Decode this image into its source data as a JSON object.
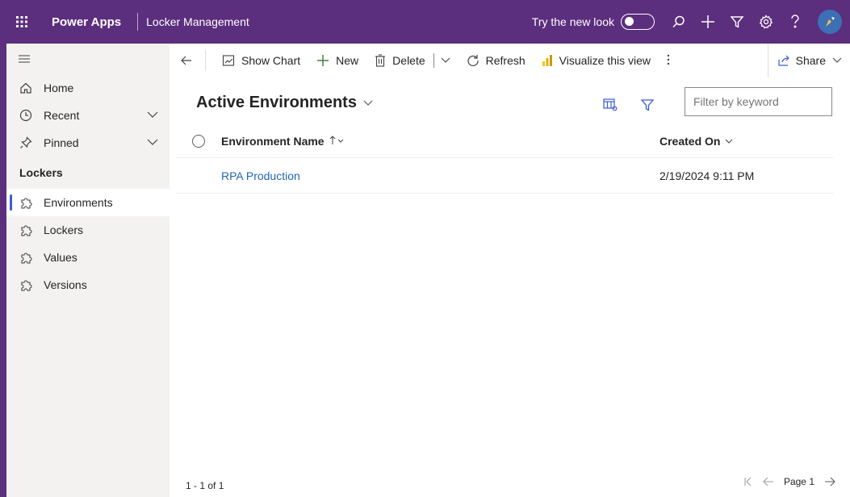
{
  "header": {
    "app_name": "Power Apps",
    "app_subtitle": "Locker Management",
    "try_new_look": "Try the new look",
    "accent": "#5c2e7e",
    "icons": [
      "waffle-icon",
      "search-icon",
      "plus-icon",
      "filter-icon",
      "settings-icon",
      "help-icon",
      "avatar"
    ]
  },
  "sidebar": {
    "items": [
      {
        "label": "Home",
        "icon": "home-icon"
      },
      {
        "label": "Recent",
        "icon": "clock-icon",
        "expandable": true
      },
      {
        "label": "Pinned",
        "icon": "pin-icon",
        "expandable": true
      }
    ],
    "group_label": "Lockers",
    "entities": [
      {
        "label": "Environments",
        "icon": "puzzle-icon",
        "selected": true
      },
      {
        "label": "Lockers",
        "icon": "puzzle-icon"
      },
      {
        "label": "Values",
        "icon": "puzzle-icon"
      },
      {
        "label": "Versions",
        "icon": "puzzle-icon"
      }
    ]
  },
  "commandbar": {
    "show_chart": "Show Chart",
    "new": "New",
    "delete": "Delete",
    "refresh": "Refresh",
    "visualize": "Visualize this view",
    "share": "Share"
  },
  "view": {
    "title": "Active Environments",
    "filter_placeholder": "Filter by keyword"
  },
  "grid": {
    "columns": [
      "Environment Name",
      "Created On"
    ],
    "rows": [
      {
        "name": "RPA Production",
        "created_on": "2/19/2024 9:11 PM"
      }
    ]
  },
  "footer": {
    "record_count": "1 - 1 of 1",
    "page_label": "Page 1"
  }
}
